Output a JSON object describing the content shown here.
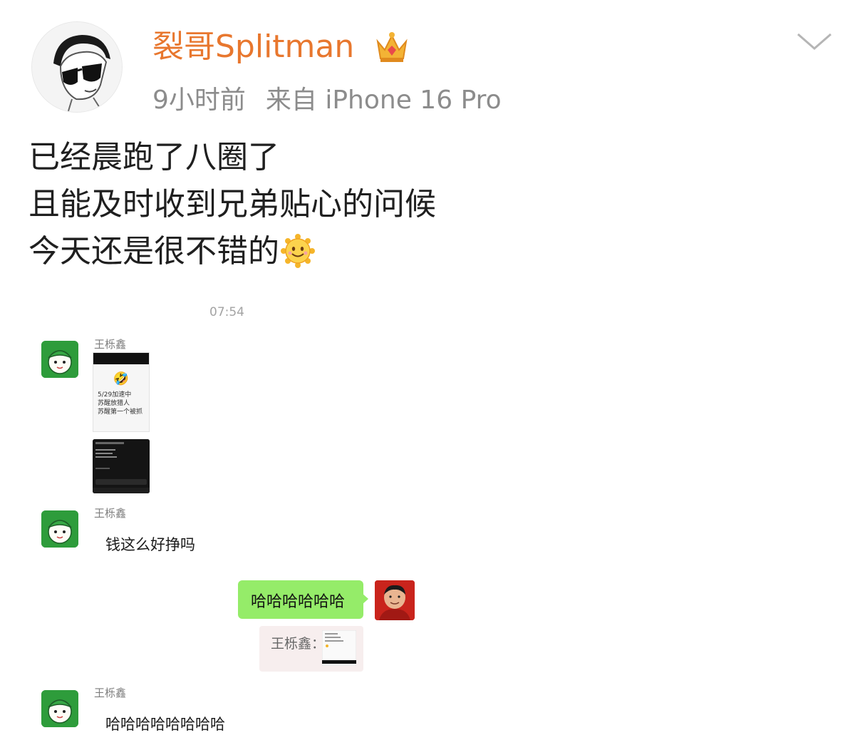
{
  "post": {
    "username": "裂哥Splitman",
    "time": "9小时前",
    "source": "来自 iPhone 16 Pro",
    "text_lines": [
      "已经晨跑了八圈了",
      "且能及时收到兄弟贴心的问候",
      "今天还是很不错的"
    ],
    "icons": {
      "avatar": "cartoon-sunglasses-avatar",
      "badge": "crown-icon",
      "menu": "chevron-down-icon",
      "emoji": "smiling-sun-emoji"
    },
    "colors": {
      "username": "#e8772e",
      "meta": "#8c8c8c"
    }
  },
  "chat": {
    "time": "07:54",
    "messages": [
      {
        "sender": "王栎鑫",
        "type": "images",
        "screenshot_lines": [
          "5/29加速中",
          "苏醒放猎人",
          "苏醒第一个被抓"
        ]
      },
      {
        "sender": "王栎鑫",
        "type": "text",
        "text": "钱这么好挣吗"
      },
      {
        "sender": "self",
        "type": "text",
        "text": "哈哈哈哈哈哈",
        "quote_label": "王栎鑫："
      },
      {
        "sender": "王栎鑫",
        "type": "text",
        "text": "哈哈哈哈哈哈哈哈"
      }
    ],
    "colors": {
      "self_bubble": "#95ec69",
      "quote_bg": "#f7eeee"
    }
  }
}
